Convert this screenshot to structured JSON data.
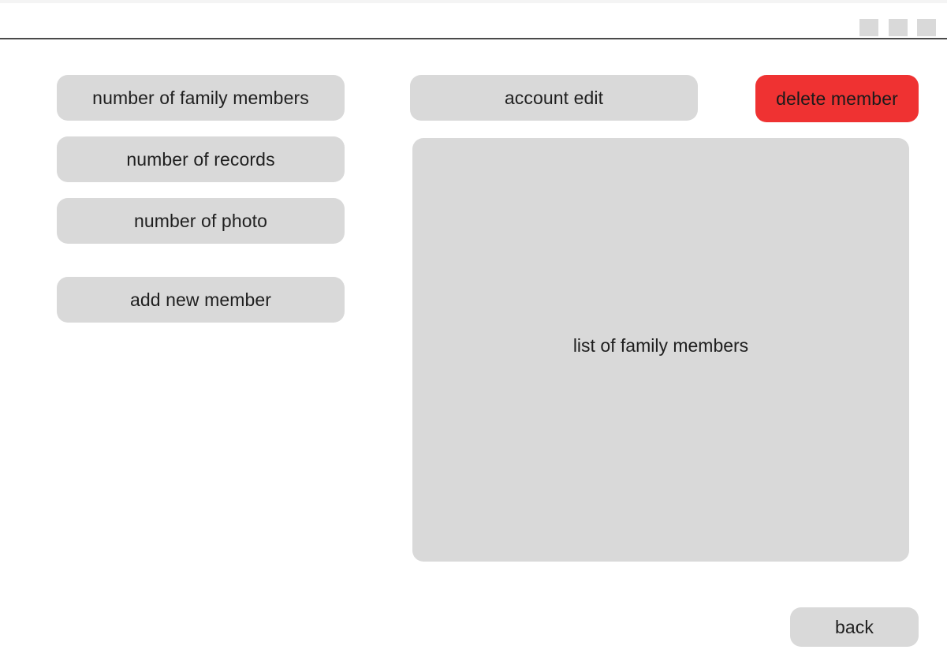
{
  "sidebar": {
    "stats": [
      {
        "label": "number of family members"
      },
      {
        "label": "number of records"
      },
      {
        "label": "number of photo"
      }
    ],
    "add_member_label": "add new member"
  },
  "toolbar": {
    "account_edit_label": "account edit",
    "delete_member_label": "delete member"
  },
  "main": {
    "member_list_label": "list of family members"
  },
  "footer": {
    "back_label": "back"
  },
  "colors": {
    "panel_gray": "#d9d9d9",
    "danger_red": "#ef3232",
    "background": "#ffffff"
  }
}
